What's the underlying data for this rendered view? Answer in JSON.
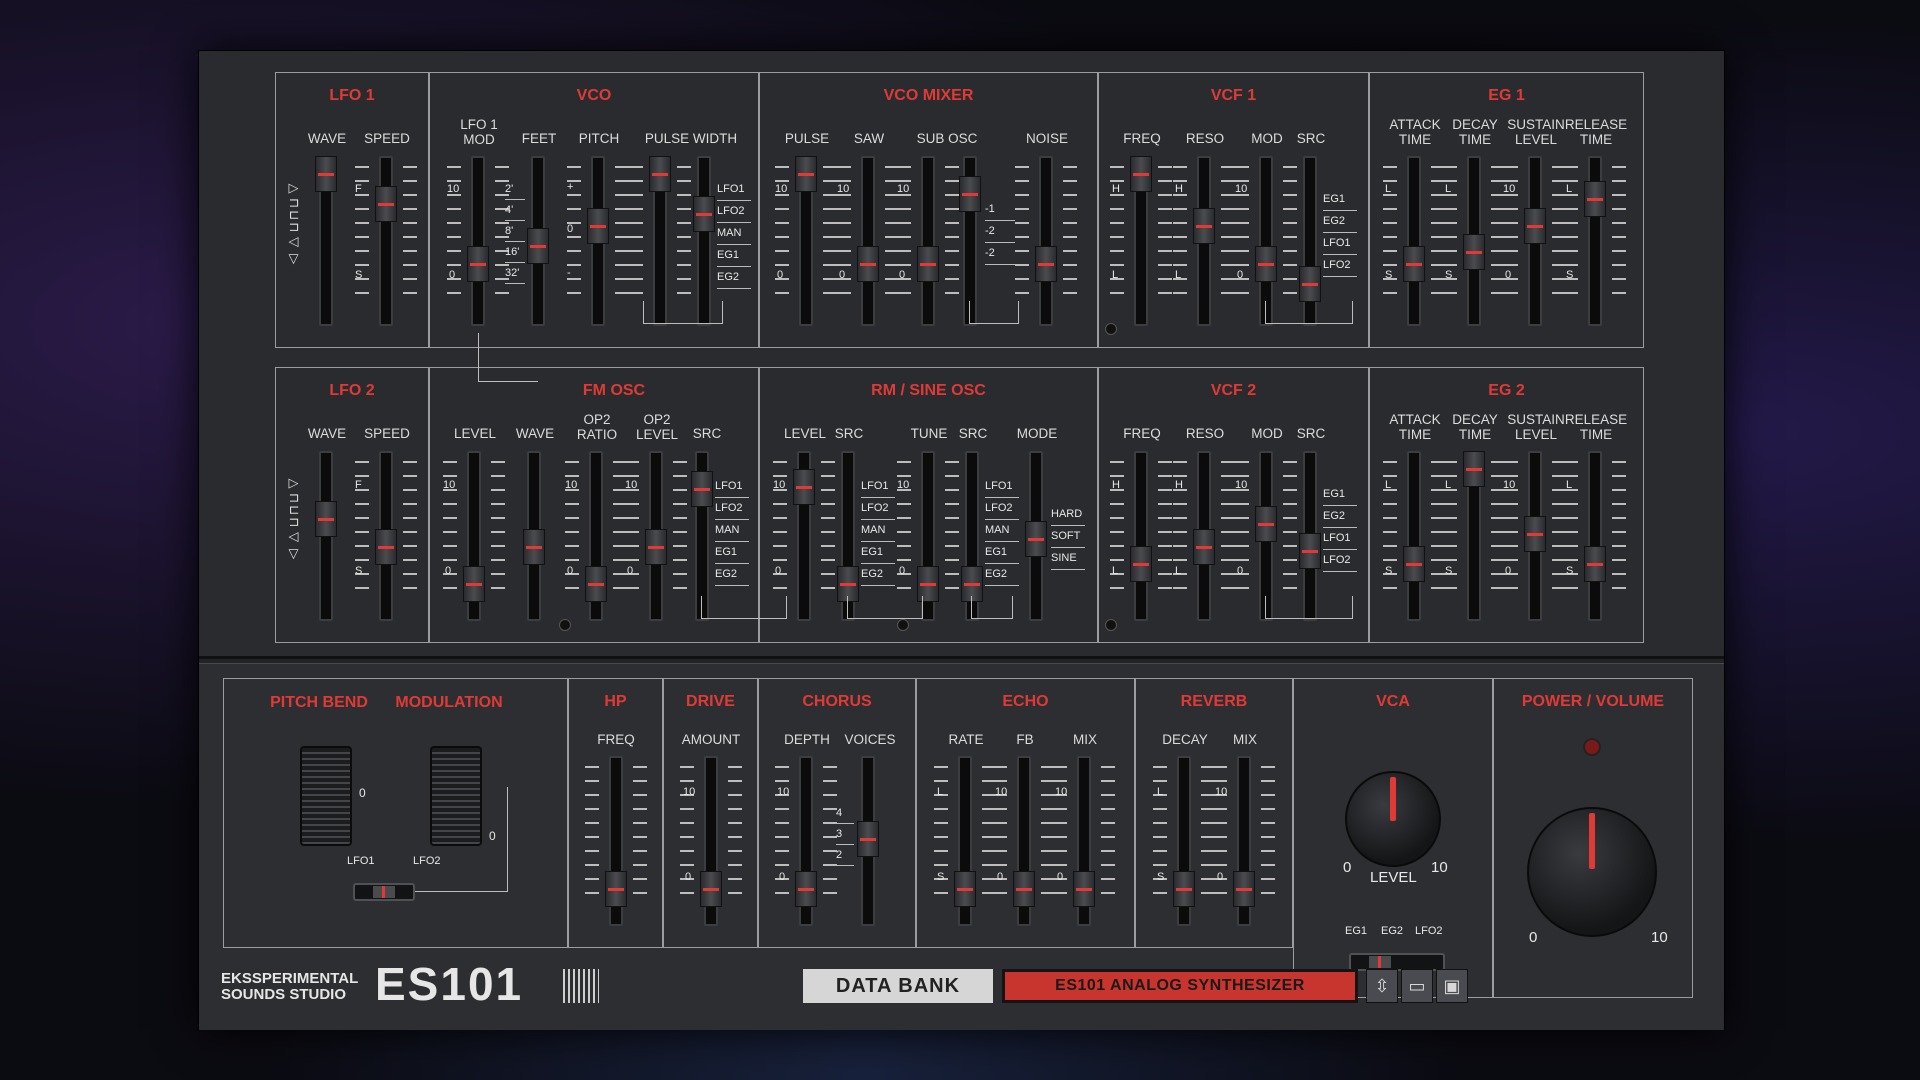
{
  "sections": {
    "lfo1": {
      "title": "LFO 1",
      "wave": "WAVE",
      "speed": "SPEED"
    },
    "vco": {
      "title": "VCO",
      "lfo1mod": "LFO 1\nMOD",
      "feet": "FEET",
      "pitch": "PITCH",
      "pulse_width": "PULSE WIDTH",
      "feet_marks": [
        "2'",
        "4'",
        "8'",
        "16'",
        "32'"
      ],
      "src": [
        "LFO1",
        "LFO2",
        "MAN",
        "EG1",
        "EG2"
      ]
    },
    "vco_mixer": {
      "title": "VCO MIXER",
      "pulse": "PULSE",
      "saw": "SAW",
      "sub_osc": "SUB OSC",
      "noise": "NOISE",
      "sub_marks": [
        "-1",
        "-2",
        "-2"
      ]
    },
    "vcf1": {
      "title": "VCF 1",
      "freq": "FREQ",
      "reso": "RESO",
      "mod": "MOD",
      "src": "SRC",
      "src_items": [
        "EG1",
        "EG2",
        "LFO1",
        "LFO2"
      ]
    },
    "eg1": {
      "title": "EG 1",
      "attack": "ATTACK\nTIME",
      "decay": "DECAY\nTIME",
      "sustain": "SUSTAIN\nLEVEL",
      "release": "RELEASE\nTIME"
    },
    "lfo2": {
      "title": "LFO 2",
      "wave": "WAVE",
      "speed": "SPEED"
    },
    "fm_osc": {
      "title": "FM OSC",
      "level": "LEVEL",
      "wave": "WAVE",
      "op2ratio": "OP2\nRATIO",
      "op2level": "OP2\nLEVEL",
      "src": "SRC",
      "src_items": [
        "LFO1",
        "LFO2",
        "MAN",
        "EG1",
        "EG2"
      ]
    },
    "rm_sine": {
      "title": "RM / SINE OSC",
      "level": "LEVEL",
      "src": "SRC",
      "tune": "TUNE",
      "src2": "SRC",
      "mode": "MODE",
      "src_items": [
        "LFO1",
        "LFO2",
        "MAN",
        "EG1",
        "EG2"
      ],
      "mode_items": [
        "HARD",
        "SOFT",
        "SINE"
      ]
    },
    "vcf2": {
      "title": "VCF 2",
      "freq": "FREQ",
      "reso": "RESO",
      "mod": "MOD",
      "src": "SRC",
      "src_items": [
        "EG1",
        "EG2",
        "LFO1",
        "LFO2"
      ]
    },
    "eg2": {
      "title": "EG 2",
      "attack": "ATTACK\nTIME",
      "decay": "DECAY\nTIME",
      "sustain": "SUSTAIN\nLEVEL",
      "release": "RELEASE\nTIME"
    },
    "pitch_bend": {
      "title": "PITCH BEND",
      "zero": "0"
    },
    "modulation": {
      "title": "MODULATION",
      "zero": "0",
      "lfo1": "LFO1",
      "lfo2": "LFO2"
    },
    "hp": {
      "title": "HP",
      "freq": "FREQ"
    },
    "drive": {
      "title": "DRIVE",
      "amount": "AMOUNT"
    },
    "chorus": {
      "title": "CHORUS",
      "depth": "DEPTH",
      "voices": "VOICES",
      "voice_marks": [
        "4",
        "3",
        "2"
      ]
    },
    "echo": {
      "title": "ECHO",
      "rate": "RATE",
      "fb": "FB",
      "mix": "MIX"
    },
    "reverb": {
      "title": "REVERB",
      "decay": "DECAY",
      "mix": "MIX"
    },
    "vca": {
      "title": "VCA",
      "level": "LEVEL",
      "min": "0",
      "max": "10",
      "eg1": "EG1",
      "eg2": "EG2",
      "lfo2": "LFO2"
    },
    "power": {
      "title": "POWER / VOLUME",
      "min": "0",
      "max": "10"
    }
  },
  "marks": {
    "ten": "10",
    "zero": "0",
    "plus": "+",
    "minus": "-",
    "f": "F",
    "s": "S",
    "h": "H",
    "l": "L"
  },
  "brand": {
    "line1": "EKSSPERIMENTAL",
    "line2": "SOUNDS STUDIO",
    "logo": "ES101"
  },
  "databank": {
    "label": "DATA BANK",
    "preset": "ES101 ANALOG SYNTHESIZER"
  },
  "icons": {
    "arrows": "up-down-arrows-icon",
    "folder": "folder-icon",
    "save": "save-icon"
  },
  "colors": {
    "accent": "#e03a36",
    "panel": "#2a2b2e"
  }
}
